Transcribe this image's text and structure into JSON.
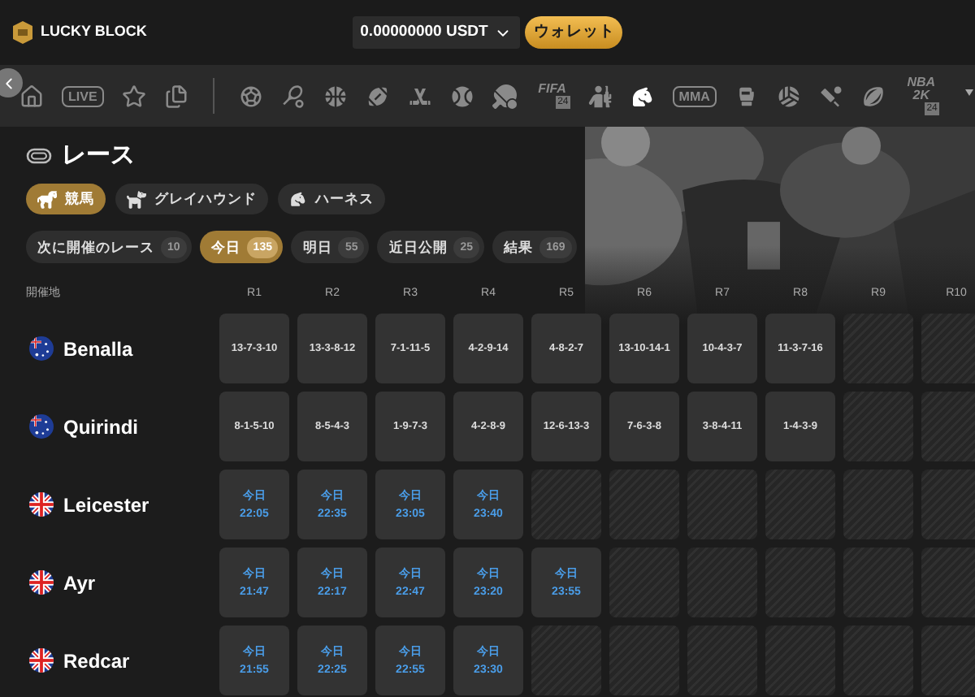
{
  "header": {
    "logo": "LUCKY BLOCK",
    "balance": "0.00000000 USDT",
    "wallet_button": "ウォレット"
  },
  "sports_nav": [
    {
      "kind": "home",
      "selected": false
    },
    {
      "kind": "text",
      "label": "LIVE",
      "selected": false
    },
    {
      "kind": "star",
      "selected": false
    },
    {
      "kind": "betslip",
      "selected": false
    },
    {
      "kind": "divider"
    },
    {
      "kind": "soccer",
      "selected": false
    },
    {
      "kind": "tennis",
      "selected": false
    },
    {
      "kind": "basketball",
      "selected": false
    },
    {
      "kind": "football",
      "selected": false
    },
    {
      "kind": "hockey",
      "selected": false
    },
    {
      "kind": "baseball",
      "selected": false
    },
    {
      "kind": "tabletennis",
      "selected": false
    },
    {
      "kind": "badge",
      "label": "FIFA",
      "sub": "24",
      "selected": false
    },
    {
      "kind": "soldier",
      "selected": false
    },
    {
      "kind": "horse",
      "selected": true
    },
    {
      "kind": "text",
      "label": "MMA",
      "selected": false
    },
    {
      "kind": "boxing",
      "selected": false
    },
    {
      "kind": "volleyball",
      "selected": false
    },
    {
      "kind": "cricket",
      "selected": false
    },
    {
      "kind": "rugby",
      "selected": false
    },
    {
      "kind": "badge",
      "label": "NBA 2K",
      "sub": "24",
      "selected": false
    }
  ],
  "title": "レース",
  "categories": [
    {
      "kind": "horse",
      "label": "競馬",
      "selected": true
    },
    {
      "kind": "dog",
      "label": "グレイハウンド",
      "selected": false
    },
    {
      "kind": "harness",
      "label": "ハーネス",
      "selected": false
    }
  ],
  "filters": [
    {
      "label": "次に開催のレース",
      "count": "10",
      "selected": false
    },
    {
      "label": "今日",
      "count": "135",
      "selected": true
    },
    {
      "label": "明日",
      "count": "55",
      "selected": false
    },
    {
      "label": "近日公開",
      "count": "25",
      "selected": false
    },
    {
      "label": "結果",
      "count": "169",
      "selected": false
    }
  ],
  "table": {
    "venue_header": "開催地",
    "columns": [
      "R1",
      "R2",
      "R3",
      "R4",
      "R5",
      "R6",
      "R7",
      "R8",
      "R9",
      "R10"
    ],
    "rows": [
      {
        "name": "Benalla",
        "kind": "au",
        "cells": [
          {
            "kind": "result",
            "text": "13-7-3-10"
          },
          {
            "kind": "result",
            "text": "13-3-8-12"
          },
          {
            "kind": "result",
            "text": "7-1-11-5"
          },
          {
            "kind": "result",
            "text": "4-2-9-14"
          },
          {
            "kind": "result",
            "text": "4-8-2-7"
          },
          {
            "kind": "result",
            "text": "13-10-14-1"
          },
          {
            "kind": "result",
            "text": "10-4-3-7"
          },
          {
            "kind": "result",
            "text": "11-3-7-16"
          },
          {
            "kind": "empty"
          },
          {
            "kind": "empty"
          }
        ]
      },
      {
        "name": "Quirindi",
        "kind": "au",
        "cells": [
          {
            "kind": "result",
            "text": "8-1-5-10"
          },
          {
            "kind": "result",
            "text": "8-5-4-3"
          },
          {
            "kind": "result",
            "text": "1-9-7-3"
          },
          {
            "kind": "result",
            "text": "4-2-8-9"
          },
          {
            "kind": "result",
            "text": "12-6-13-3"
          },
          {
            "kind": "result",
            "text": "7-6-3-8"
          },
          {
            "kind": "result",
            "text": "3-8-4-11"
          },
          {
            "kind": "result",
            "text": "1-4-3-9"
          },
          {
            "kind": "empty"
          },
          {
            "kind": "empty"
          }
        ]
      },
      {
        "name": "Leicester",
        "kind": "gb",
        "cells": [
          {
            "kind": "time",
            "day": "今日",
            "time": "22:05"
          },
          {
            "kind": "time",
            "day": "今日",
            "time": "22:35"
          },
          {
            "kind": "time",
            "day": "今日",
            "time": "23:05"
          },
          {
            "kind": "time",
            "day": "今日",
            "time": "23:40"
          },
          {
            "kind": "empty"
          },
          {
            "kind": "empty"
          },
          {
            "kind": "empty"
          },
          {
            "kind": "empty"
          },
          {
            "kind": "empty"
          },
          {
            "kind": "empty"
          }
        ]
      },
      {
        "name": "Ayr",
        "kind": "gb",
        "cells": [
          {
            "kind": "time",
            "day": "今日",
            "time": "21:47"
          },
          {
            "kind": "time",
            "day": "今日",
            "time": "22:17"
          },
          {
            "kind": "time",
            "day": "今日",
            "time": "22:47"
          },
          {
            "kind": "time",
            "day": "今日",
            "time": "23:20"
          },
          {
            "kind": "time",
            "day": "今日",
            "time": "23:55"
          },
          {
            "kind": "empty"
          },
          {
            "kind": "empty"
          },
          {
            "kind": "empty"
          },
          {
            "kind": "empty"
          },
          {
            "kind": "empty"
          }
        ]
      },
      {
        "name": "Redcar",
        "kind": "gb",
        "cells": [
          {
            "kind": "time",
            "day": "今日",
            "time": "21:55"
          },
          {
            "kind": "time",
            "day": "今日",
            "time": "22:25"
          },
          {
            "kind": "time",
            "day": "今日",
            "time": "22:55"
          },
          {
            "kind": "time",
            "day": "今日",
            "time": "23:30"
          },
          {
            "kind": "empty"
          },
          {
            "kind": "empty"
          },
          {
            "kind": "empty"
          },
          {
            "kind": "empty"
          },
          {
            "kind": "empty"
          },
          {
            "kind": "empty"
          }
        ]
      }
    ]
  }
}
